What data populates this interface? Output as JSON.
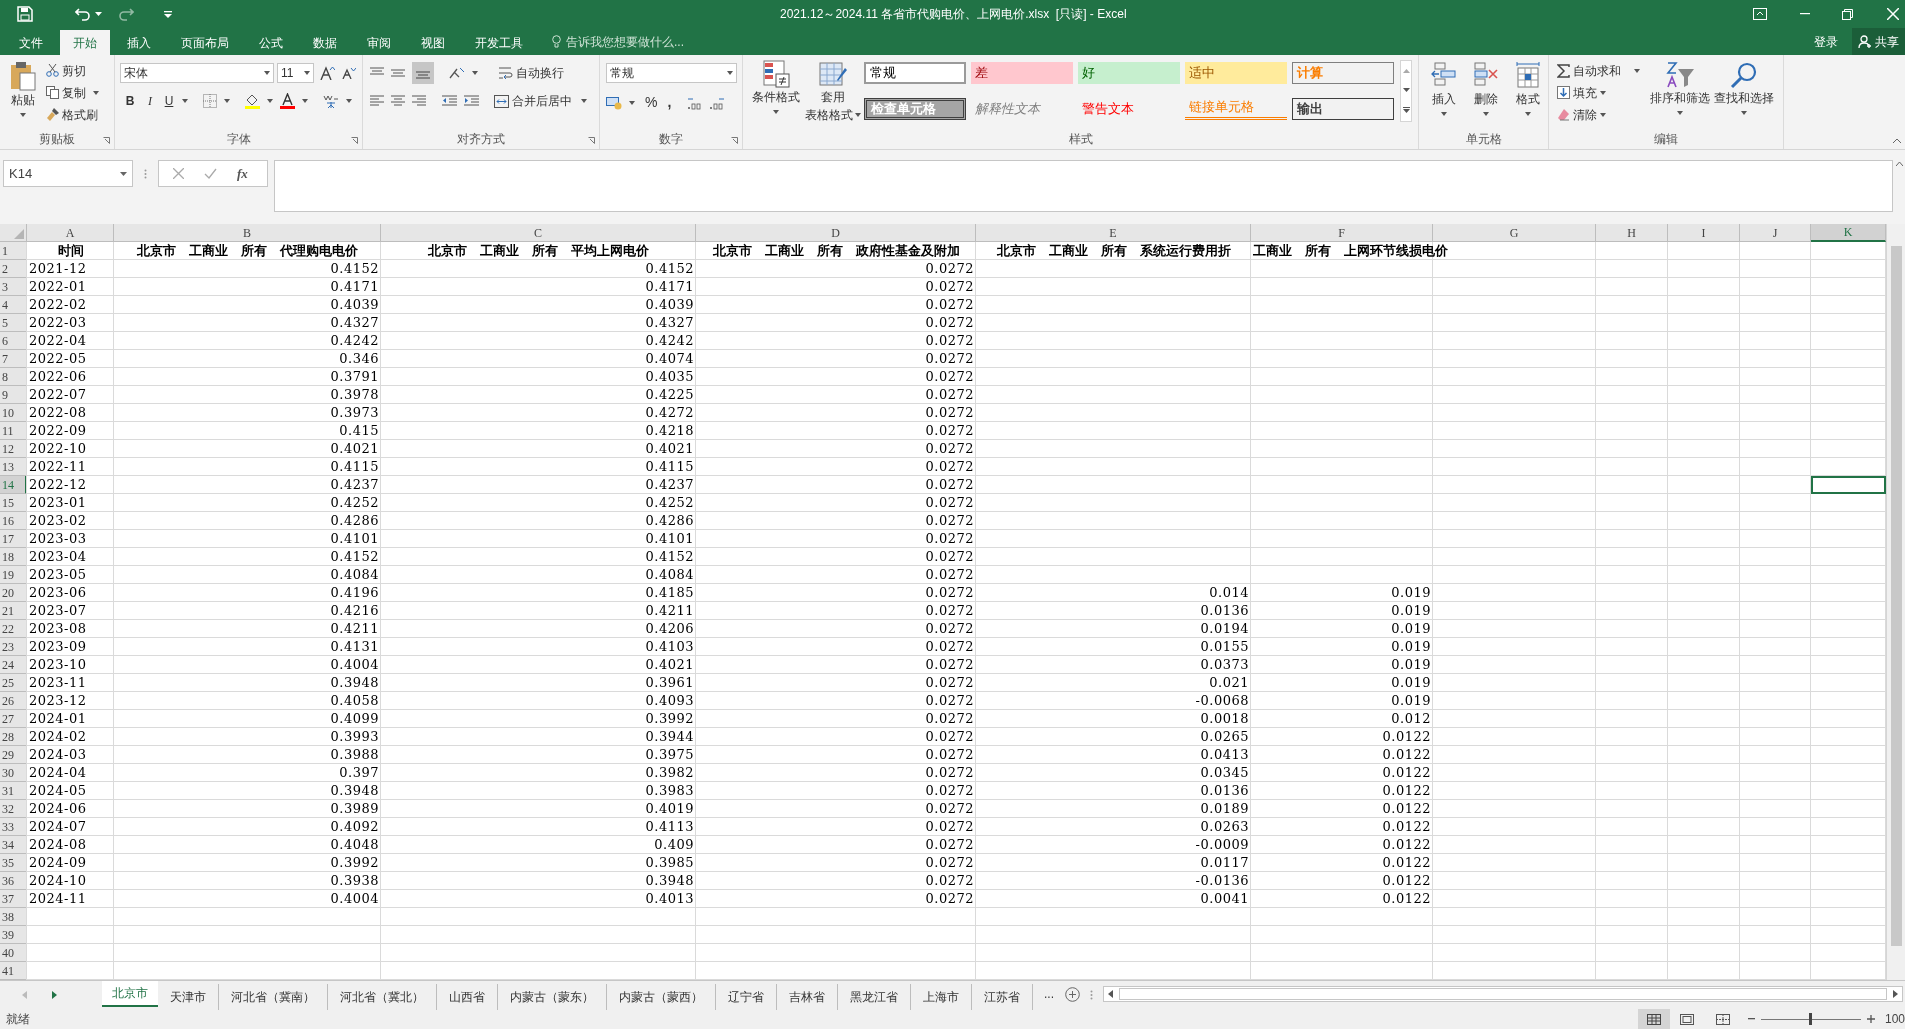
{
  "window": {
    "title": "2021.12～2024.11 各省市代购电价、上网电价.xlsx  [只读] - Excel"
  },
  "menu_tabs": [
    {
      "label": "文件",
      "selected": false
    },
    {
      "label": "开始",
      "selected": true
    },
    {
      "label": "插入",
      "selected": false
    },
    {
      "label": "页面布局",
      "selected": false
    },
    {
      "label": "公式",
      "selected": false
    },
    {
      "label": "数据",
      "selected": false
    },
    {
      "label": "审阅",
      "selected": false
    },
    {
      "label": "视图",
      "selected": false
    },
    {
      "label": "开发工具",
      "selected": false
    }
  ],
  "tell_me": {
    "placeholder": "告诉我您想要做什么..."
  },
  "account": {
    "sign_in": "登录",
    "share": "共享"
  },
  "ribbon": {
    "clipboard": {
      "label": "剪贴板",
      "paste": "粘贴",
      "cut": "剪切",
      "copy": "复制",
      "format_painter": "格式刷"
    },
    "font": {
      "label": "字体",
      "name": "宋体",
      "size": "11",
      "bold": "B",
      "italic": "I",
      "underline": "U"
    },
    "alignment": {
      "label": "对齐方式",
      "wrap_text": "自动换行",
      "merge_center": "合并后居中"
    },
    "number": {
      "label": "数字",
      "format": "常规",
      "percent": "%",
      "comma": ","
    },
    "styles": {
      "label": "样式",
      "conditional_formatting": "条件格式",
      "format_as_table_1": "套用",
      "format_as_table_2": "表格格式",
      "cell_styles": [
        {
          "label": "常规",
          "kind": "normal"
        },
        {
          "label": "差",
          "kind": "bad"
        },
        {
          "label": "好",
          "kind": "good"
        },
        {
          "label": "适中",
          "kind": "neutral"
        },
        {
          "label": "计算",
          "kind": "calculation"
        },
        {
          "label": "检查单元格",
          "kind": "check"
        },
        {
          "label": "解释性文本",
          "kind": "explanatory"
        },
        {
          "label": "警告文本",
          "kind": "warning"
        },
        {
          "label": "链接单元格",
          "kind": "linked"
        },
        {
          "label": "输出",
          "kind": "output"
        }
      ]
    },
    "cells": {
      "label": "单元格",
      "insert": "插入",
      "delete": "删除",
      "format": "格式"
    },
    "editing": {
      "label": "编辑",
      "autosum": "自动求和",
      "fill": "填充",
      "clear": "清除",
      "sort_filter": "排序和筛选",
      "find_select": "查找和选择"
    }
  },
  "formula_bar": {
    "name_box": "K14",
    "fx": "fx"
  },
  "sheet": {
    "columns": [
      {
        "letter": "A",
        "selected": false
      },
      {
        "letter": "B",
        "selected": false
      },
      {
        "letter": "C",
        "selected": false
      },
      {
        "letter": "D",
        "selected": false
      },
      {
        "letter": "E",
        "selected": false
      },
      {
        "letter": "F",
        "selected": false
      },
      {
        "letter": "G",
        "selected": false
      },
      {
        "letter": "H",
        "selected": false
      },
      {
        "letter": "I",
        "selected": false
      },
      {
        "letter": "J",
        "selected": false
      },
      {
        "letter": "K",
        "selected": true
      }
    ],
    "rows": [
      {
        "number": "1",
        "selected": false,
        "header": true,
        "cells": [
          "时间",
          "北京市　工商业　所有　代理购电电价",
          "北京市　工商业　所有　平均上网电价",
          "北京市　工商业　所有　政府性基金及附加",
          "北京市　工商业　所有　系统运行费用折",
          "工商业　所有　上网环节线损电价"
        ]
      },
      {
        "number": "2",
        "selected": false,
        "cells": [
          "2021-12",
          "0.4152",
          "0.4152",
          "0.0272"
        ]
      },
      {
        "number": "3",
        "selected": false,
        "cells": [
          "2022-01",
          "0.4171",
          "0.4171",
          "0.0272"
        ]
      },
      {
        "number": "4",
        "selected": false,
        "cells": [
          "2022-02",
          "0.4039",
          "0.4039",
          "0.0272"
        ]
      },
      {
        "number": "5",
        "selected": false,
        "cells": [
          "2022-03",
          "0.4327",
          "0.4327",
          "0.0272"
        ]
      },
      {
        "number": "6",
        "selected": false,
        "cells": [
          "2022-04",
          "0.4242",
          "0.4242",
          "0.0272"
        ]
      },
      {
        "number": "7",
        "selected": false,
        "cells": [
          "2022-05",
          "0.346",
          "0.4074",
          "0.0272"
        ]
      },
      {
        "number": "8",
        "selected": false,
        "cells": [
          "2022-06",
          "0.3791",
          "0.4035",
          "0.0272"
        ]
      },
      {
        "number": "9",
        "selected": false,
        "cells": [
          "2022-07",
          "0.3978",
          "0.4225",
          "0.0272"
        ]
      },
      {
        "number": "10",
        "selected": false,
        "cells": [
          "2022-08",
          "0.3973",
          "0.4272",
          "0.0272"
        ]
      },
      {
        "number": "11",
        "selected": false,
        "cells": [
          "2022-09",
          "0.415",
          "0.4218",
          "0.0272"
        ]
      },
      {
        "number": "12",
        "selected": false,
        "cells": [
          "2022-10",
          "0.4021",
          "0.4021",
          "0.0272"
        ]
      },
      {
        "number": "13",
        "selected": false,
        "cells": [
          "2022-11",
          "0.4115",
          "0.4115",
          "0.0272"
        ]
      },
      {
        "number": "14",
        "selected": true,
        "cells": [
          "2022-12",
          "0.4237",
          "0.4237",
          "0.0272"
        ]
      },
      {
        "number": "15",
        "selected": false,
        "cells": [
          "2023-01",
          "0.4252",
          "0.4252",
          "0.0272"
        ]
      },
      {
        "number": "16",
        "selected": false,
        "cells": [
          "2023-02",
          "0.4286",
          "0.4286",
          "0.0272"
        ]
      },
      {
        "number": "17",
        "selected": false,
        "cells": [
          "2023-03",
          "0.4101",
          "0.4101",
          "0.0272"
        ]
      },
      {
        "number": "18",
        "selected": false,
        "cells": [
          "2023-04",
          "0.4152",
          "0.4152",
          "0.0272"
        ]
      },
      {
        "number": "19",
        "selected": false,
        "cells": [
          "2023-05",
          "0.4084",
          "0.4084",
          "0.0272"
        ]
      },
      {
        "number": "20",
        "selected": false,
        "cells": [
          "2023-06",
          "0.4196",
          "0.4185",
          "0.0272",
          "0.014",
          "0.019"
        ]
      },
      {
        "number": "21",
        "selected": false,
        "cells": [
          "2023-07",
          "0.4216",
          "0.4211",
          "0.0272",
          "0.0136",
          "0.019"
        ]
      },
      {
        "number": "22",
        "selected": false,
        "cells": [
          "2023-08",
          "0.4211",
          "0.4206",
          "0.0272",
          "0.0194",
          "0.019"
        ]
      },
      {
        "number": "23",
        "selected": false,
        "cells": [
          "2023-09",
          "0.4131",
          "0.4103",
          "0.0272",
          "0.0155",
          "0.019"
        ]
      },
      {
        "number": "24",
        "selected": false,
        "cells": [
          "2023-10",
          "0.4004",
          "0.4021",
          "0.0272",
          "0.0373",
          "0.019"
        ]
      },
      {
        "number": "25",
        "selected": false,
        "cells": [
          "2023-11",
          "0.3948",
          "0.3961",
          "0.0272",
          "0.021",
          "0.019"
        ]
      },
      {
        "number": "26",
        "selected": false,
        "cells": [
          "2023-12",
          "0.4058",
          "0.4093",
          "0.0272",
          "-0.0068",
          "0.019"
        ]
      },
      {
        "number": "27",
        "selected": false,
        "cells": [
          "2024-01",
          "0.4099",
          "0.3992",
          "0.0272",
          "0.0018",
          "0.012"
        ]
      },
      {
        "number": "28",
        "selected": false,
        "cells": [
          "2024-02",
          "0.3993",
          "0.3944",
          "0.0272",
          "0.0265",
          "0.0122"
        ]
      },
      {
        "number": "29",
        "selected": false,
        "cells": [
          "2024-03",
          "0.3988",
          "0.3975",
          "0.0272",
          "0.0413",
          "0.0122"
        ]
      },
      {
        "number": "30",
        "selected": false,
        "cells": [
          "2024-04",
          "0.397",
          "0.3982",
          "0.0272",
          "0.0345",
          "0.0122"
        ]
      },
      {
        "number": "31",
        "selected": false,
        "cells": [
          "2024-05",
          "0.3948",
          "0.3983",
          "0.0272",
          "0.0136",
          "0.0122"
        ]
      },
      {
        "number": "32",
        "selected": false,
        "cells": [
          "2024-06",
          "0.3989",
          "0.4019",
          "0.0272",
          "0.0189",
          "0.0122"
        ]
      },
      {
        "number": "33",
        "selected": false,
        "cells": [
          "2024-07",
          "0.4092",
          "0.4113",
          "0.0272",
          "0.0263",
          "0.0122"
        ]
      },
      {
        "number": "34",
        "selected": false,
        "cells": [
          "2024-08",
          "0.4048",
          "0.409",
          "0.0272",
          "-0.0009",
          "0.0122"
        ]
      },
      {
        "number": "35",
        "selected": false,
        "cells": [
          "2024-09",
          "0.3992",
          "0.3985",
          "0.0272",
          "0.0117",
          "0.0122"
        ]
      },
      {
        "number": "36",
        "selected": false,
        "cells": [
          "2024-10",
          "0.3938",
          "0.3948",
          "0.0272",
          "-0.0136",
          "0.0122"
        ]
      },
      {
        "number": "37",
        "selected": false,
        "cells": [
          "2024-11",
          "0.4004",
          "0.4013",
          "0.0272",
          "0.0041",
          "0.0122"
        ]
      },
      {
        "number": "38",
        "selected": false
      },
      {
        "number": "39",
        "selected": false
      },
      {
        "number": "40",
        "selected": false
      },
      {
        "number": "41",
        "selected": false
      }
    ]
  },
  "sheet_tabs": [
    {
      "label": "北京市",
      "selected": true
    },
    {
      "label": "天津市",
      "selected": false
    },
    {
      "label": "河北省（冀南）",
      "selected": false
    },
    {
      "label": "河北省（冀北）",
      "selected": false
    },
    {
      "label": "山西省",
      "selected": false
    },
    {
      "label": "内蒙古（蒙东）",
      "selected": false
    },
    {
      "label": "内蒙古（蒙西）",
      "selected": false
    },
    {
      "label": "辽宁省",
      "selected": false
    },
    {
      "label": "吉林省",
      "selected": false
    },
    {
      "label": "黑龙江省",
      "selected": false
    },
    {
      "label": "上海市",
      "selected": false
    },
    {
      "label": "江苏省",
      "selected": false
    }
  ],
  "more_sheets": "...",
  "status_bar": {
    "mode": "就绪",
    "zoom": "100",
    "zoom_slider": {
      "level": 0.5
    }
  }
}
